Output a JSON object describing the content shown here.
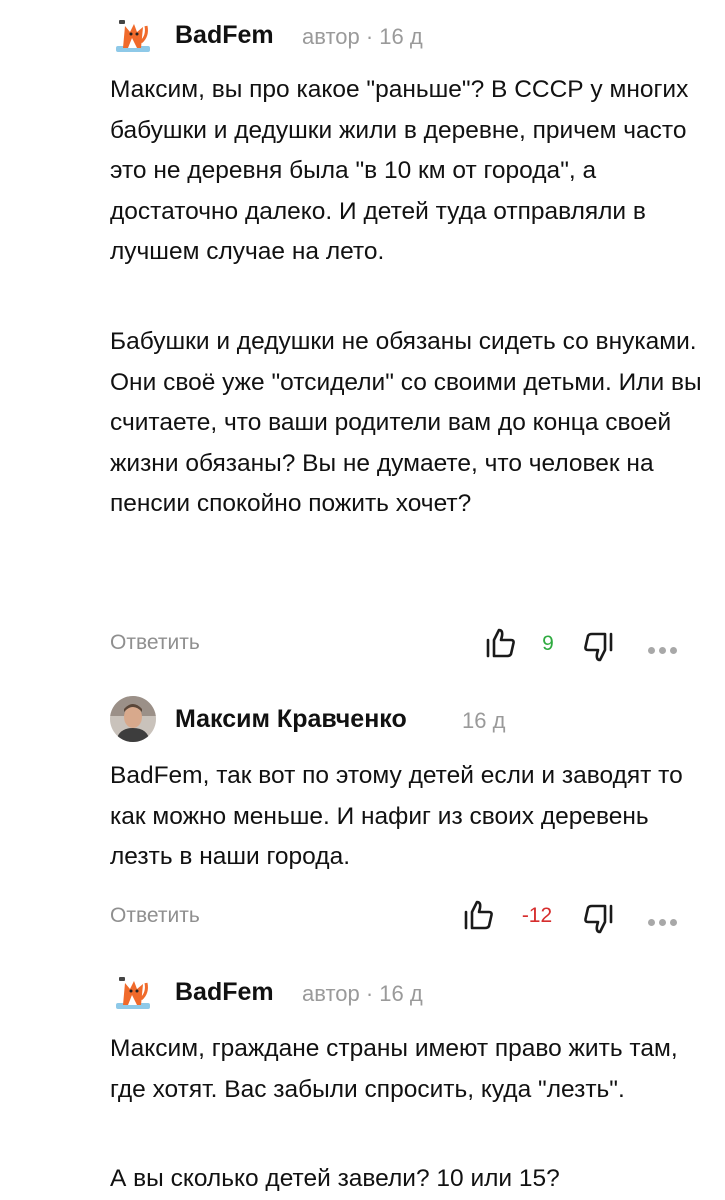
{
  "comments": [
    {
      "author": "BadFem",
      "meta": "автор · 16 д",
      "paragraphs": [
        "Максим, вы про какое \"раньше\"? В СССР у многих бабушки и дедушки жили в деревне, причем часто это не деревня была \"в 10 км от города\", а достаточно далеко. И детей туда отправляли в лучшем случае на лето.",
        "Бабушки и дедушки не обязаны сидеть со внуками. Они своё уже \"отсидели\" со своими детьми. Или вы считаете, что ваши родители вам до конца своей жизни обязаны? Вы не думаете, что человек на пенсии спокойно пожить хочет?"
      ],
      "reply_label": "Ответить",
      "score": "9",
      "score_color": "#2eaa3f",
      "avatar_icon": "fox-icon"
    },
    {
      "author": "Максим Кравченко",
      "meta": "16 д",
      "paragraphs": [
        "BadFem, так вот по этому детей если и заводят то как можно меньше. И нафиг из своих деревень лезть в наши города."
      ],
      "reply_label": "Ответить",
      "score": "-12",
      "score_color": "#d62d2d",
      "avatar_icon": "user-photo-avatar"
    },
    {
      "author": "BadFem",
      "meta": "автор · 16 д",
      "paragraphs": [
        "Максим, граждане страны имеют право жить там, где хотят. Вас забыли спросить, куда \"лезть\".",
        "А вы сколько детей завели? 10 или 15?"
      ],
      "avatar_icon": "fox-icon"
    }
  ],
  "icons": {
    "like": "thumbs-up-icon",
    "dislike": "thumbs-down-icon",
    "more": "more-dots-icon"
  }
}
